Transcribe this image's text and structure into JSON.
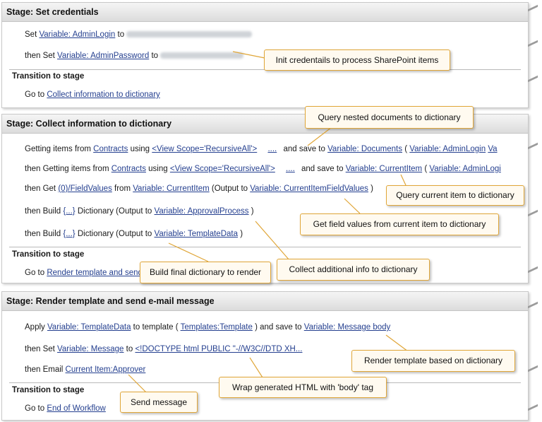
{
  "stage1": {
    "header": "Stage: Set credentials",
    "row1": {
      "set": "Set",
      "var": "Variable: AdminLogin",
      "to": "to"
    },
    "row2": {
      "set": "then Set",
      "var": "Variable: AdminPassword",
      "to": "to"
    },
    "transition": "Transition to stage",
    "goto": {
      "label": "Go to",
      "target": "Collect information to dictionary"
    }
  },
  "stage2": {
    "header": "Stage: Collect information to dictionary",
    "row1": {
      "a": "Getting items from",
      "list": "Contracts",
      "using": "using",
      "query": "<View Scope='RecursiveAll'>",
      "dots": "....",
      "save": "and save to",
      "var": "Variable: Documents",
      "paren": "(",
      "login": "Variable: AdminLogin",
      "tail": "Va"
    },
    "row2": {
      "a": "then Getting items from",
      "list": "Contracts",
      "using": "using",
      "query": "<View Scope='RecursiveAll'>",
      "dots": "....",
      "save": "and save to",
      "var": "Variable: CurrentItem",
      "paren": "(",
      "login": "Variable: AdminLogi"
    },
    "row3": {
      "a": "then Get",
      "field": "(0)/FieldValues",
      "from": "from",
      "var": "Variable: CurrentItem",
      "out": "(Output to",
      "outvar": "Variable: CurrentItemFieldValues",
      "close": ")"
    },
    "row4": {
      "a": "then Build",
      "dict": "{...}",
      "b": "Dictionary (Output to",
      "var": "Variable: ApprovalProcess",
      "close": ")"
    },
    "row5": {
      "a": "then Build",
      "dict": "{...}",
      "b": "Dictionary (Output to",
      "var": "Variable: TemplateData",
      "close": ")"
    },
    "transition": "Transition to stage",
    "goto": {
      "label": "Go to",
      "target": "Render template and send"
    }
  },
  "stage3": {
    "header": "Stage: Render template and send e-mail message",
    "row1": {
      "a": "Apply",
      "var": "Variable: TemplateData",
      "b": "to template (",
      "tpl": "Templates:Template",
      "c": ") and save to",
      "out": "Variable: Message body"
    },
    "row2": {
      "a": "then Set",
      "var": "Variable: Message",
      "to": "to",
      "val": "<!DOCTYPE html PUBLIC \"-//W3C//DTD XH..."
    },
    "row3": {
      "a": "then Email",
      "who": "Current Item:Approver"
    },
    "transition": "Transition to stage",
    "goto": {
      "label": "Go to",
      "target": "End of Workflow"
    }
  },
  "callouts": {
    "init": "Init credentails to process SharePoint items",
    "query_nested": "Query nested documents to dictionary",
    "query_current": "Query current item to dictionary",
    "field_values": "Get field values from current item to dictionary",
    "build_final": "Build final dictionary to render",
    "collect_additional": "Collect additional info to dictionary",
    "render_template": "Render template based on dictionary",
    "wrap_html": "Wrap generated HTML with 'body' tag",
    "send_message": "Send message"
  }
}
